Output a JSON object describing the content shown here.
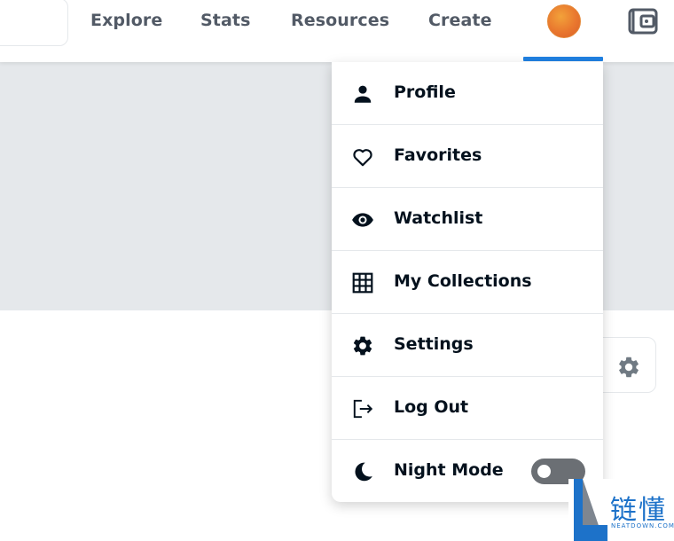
{
  "header": {
    "nav": [
      {
        "label": "Explore"
      },
      {
        "label": "Stats"
      },
      {
        "label": "Resources"
      },
      {
        "label": "Create"
      }
    ],
    "wallet_icon": "wallet-icon",
    "avatar_icon": "avatar"
  },
  "menu": {
    "items": [
      {
        "label": "Profile",
        "icon": "person-icon"
      },
      {
        "label": "Favorites",
        "icon": "heart-icon"
      },
      {
        "label": "Watchlist",
        "icon": "eye-icon"
      },
      {
        "label": "My Collections",
        "icon": "grid-icon"
      },
      {
        "label": "Settings",
        "icon": "gear-icon"
      },
      {
        "label": "Log Out",
        "icon": "logout-icon"
      },
      {
        "label": "Night Mode",
        "icon": "moon-icon",
        "toggle": false
      }
    ]
  },
  "side_button_icon": "gear-icon",
  "watermark": {
    "cn": "链懂",
    "en": "NEATDOWN.COM"
  },
  "colors": {
    "accent": "#2081e2",
    "text": "#04111d",
    "nav_text": "#525a66",
    "hero_bg": "#e5e8eb",
    "toggle_off": "#6b6f74"
  }
}
